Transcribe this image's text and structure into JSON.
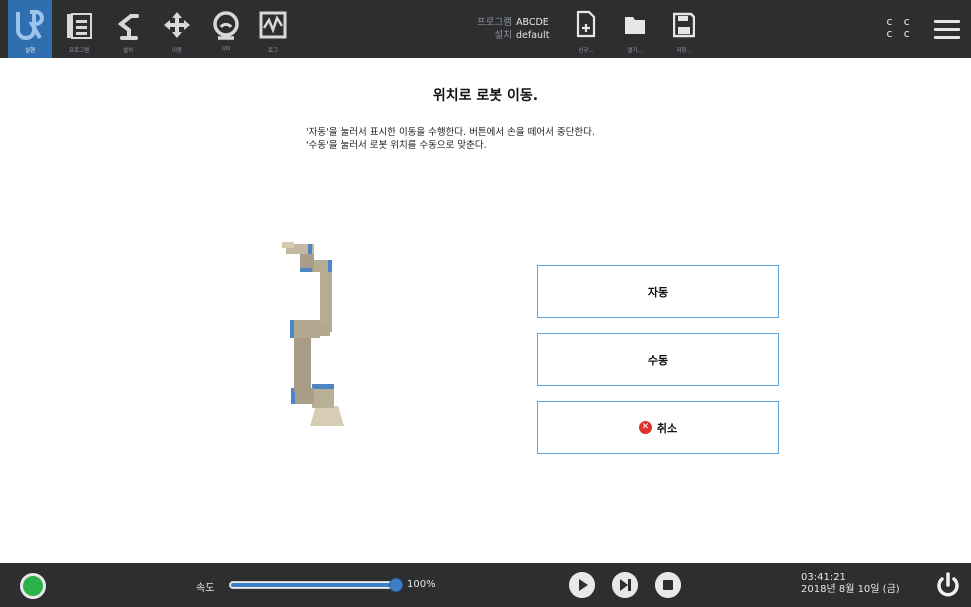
{
  "topbar": {
    "tabs": [
      {
        "label": "실행",
        "icon": "ur-logo-icon"
      },
      {
        "label": "프로그램",
        "icon": "program-icon"
      },
      {
        "label": "설치",
        "icon": "installation-icon"
      },
      {
        "label": "이동",
        "icon": "move-icon"
      },
      {
        "label": "I/O",
        "icon": "io-icon"
      },
      {
        "label": "로그",
        "icon": "log-icon"
      }
    ],
    "program_key": "프로그램",
    "program_value": "ABCDE",
    "install_key": "설치",
    "install_value": "default",
    "file_buttons": [
      {
        "label": "신규...",
        "icon": "new-file-icon"
      },
      {
        "label": "열기...",
        "icon": "open-folder-icon"
      },
      {
        "label": "저장...",
        "icon": "save-icon"
      }
    ],
    "cc_line1": "c c",
    "cc_line2": "c c",
    "menu_icon": "hamburger-menu-icon"
  },
  "main": {
    "title": "위치로 로봇 이동.",
    "description_line1": "'자동'을 눌러서 표시한 이동을 수행한다. 버튼에서 손을 떼어서 중단한다.",
    "description_line2": "'수동'을 눌러서 로봇 위치를 수동으로 맞춘다.",
    "auto_button": "자동",
    "manual_button": "수동",
    "cancel_button": "취소",
    "cancel_icon": "cancel-x-icon"
  },
  "bottombar": {
    "speed_label": "속도",
    "speed_value": "100%",
    "speed_fraction": 1.0,
    "time": "03:41:21",
    "date": "2018년 8월 10일 (금)",
    "status_color": "#2bb34a",
    "accent_color": "#3d7fc4"
  }
}
